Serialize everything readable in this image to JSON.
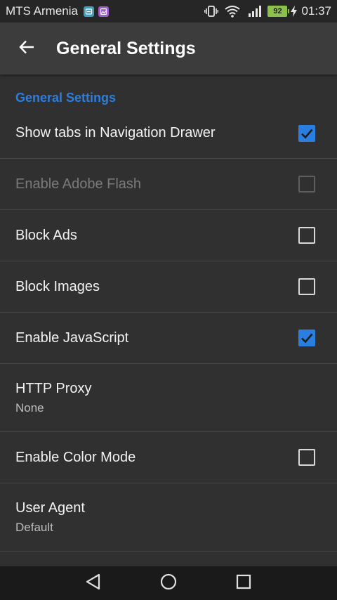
{
  "status_bar": {
    "carrier": "MTS Armenia",
    "battery_level": "92",
    "time": "01:37",
    "icons": [
      "notification-app-icon",
      "notification-gallery-icon",
      "vibrate-icon",
      "wifi-icon",
      "signal-icon",
      "battery-icon",
      "charging-icon"
    ]
  },
  "app_bar": {
    "title": "General Settings",
    "back_icon": "arrow-back-icon"
  },
  "category": {
    "title": "General Settings",
    "color": "#2a7ee0"
  },
  "preferences": [
    {
      "title": "Show tabs in Navigation Drawer",
      "checked": true,
      "enabled": true
    },
    {
      "title": "Enable Adobe Flash",
      "checked": false,
      "enabled": false
    },
    {
      "title": "Block Ads",
      "checked": false,
      "enabled": true
    },
    {
      "title": "Block Images",
      "checked": false,
      "enabled": true
    },
    {
      "title": "Enable JavaScript",
      "checked": true,
      "enabled": true
    },
    {
      "title": "HTTP Proxy",
      "summary": "None"
    },
    {
      "title": "Enable Color Mode",
      "checked": false,
      "enabled": true
    },
    {
      "title": "User Agent",
      "summary": "Default"
    }
  ],
  "nav_bar": {
    "icons": [
      "back-triangle-icon",
      "home-circle-icon",
      "recents-square-icon"
    ]
  },
  "colors": {
    "background": "#303030",
    "app_bar": "#3c3c3c",
    "accent": "#2a7ee0",
    "battery": "#8bc34a"
  }
}
